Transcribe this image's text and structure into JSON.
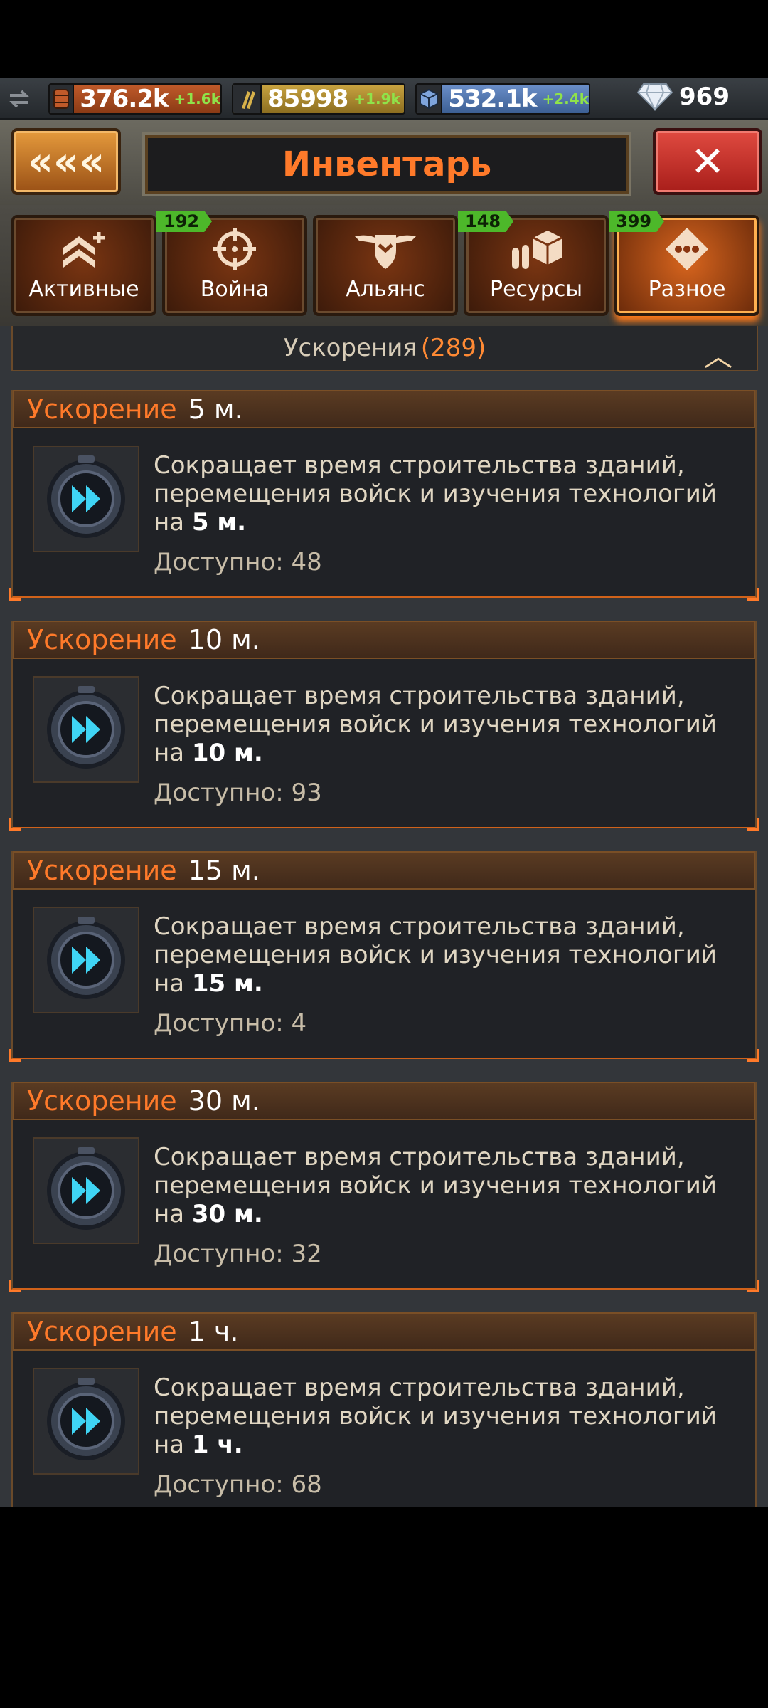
{
  "resources": [
    {
      "value": "376.2k",
      "increment": "+1.6k",
      "icon": "oil-barrel-icon"
    },
    {
      "value": "85998",
      "increment": "+1.9k",
      "icon": "ammo-icon"
    },
    {
      "value": "532.1k",
      "increment": "+2.4k",
      "icon": "metal-cube-icon"
    }
  ],
  "gems": {
    "value": "969",
    "icon": "diamond-icon"
  },
  "header": {
    "back_label": "«««",
    "title": "Инвентарь",
    "close_label": "✕"
  },
  "tabs": [
    {
      "label": "Активные",
      "badge": "",
      "icon": "rank-plus-icon"
    },
    {
      "label": "Война",
      "badge": "192",
      "icon": "crosshair-icon"
    },
    {
      "label": "Альянс",
      "badge": "",
      "icon": "wings-shield-icon"
    },
    {
      "label": "Ресурсы",
      "badge": "148",
      "icon": "resources-icon"
    },
    {
      "label": "Разное",
      "badge": "399",
      "icon": "dice-icon"
    }
  ],
  "category": {
    "title": "Ускорения",
    "count": "(289)"
  },
  "items": [
    {
      "name": "Ускорение",
      "amount": "5 м.",
      "description": "Сокращает время строительства зданий, перемещения войск и изучения технологий на",
      "available": "Доступно: 48"
    },
    {
      "name": "Ускорение",
      "amount": "10 м.",
      "description": "Сокращает время строительства зданий, перемещения войск и изучения технологий на",
      "available": "Доступно: 93"
    },
    {
      "name": "Ускорение",
      "amount": "15 м.",
      "description": "Сокращает время строительства зданий, перемещения войск и изучения технологий на",
      "available": "Доступно: 4"
    },
    {
      "name": "Ускорение",
      "amount": "30 м.",
      "description": "Сокращает время строительства зданий, перемещения войск и изучения технологий на",
      "available": "Доступно: 32"
    },
    {
      "name": "Ускорение",
      "amount": "1 ч.",
      "description": "Сокращает время строительства зданий, перемещения войск и изучения технологий на",
      "available": "Доступно: 68"
    }
  ]
}
